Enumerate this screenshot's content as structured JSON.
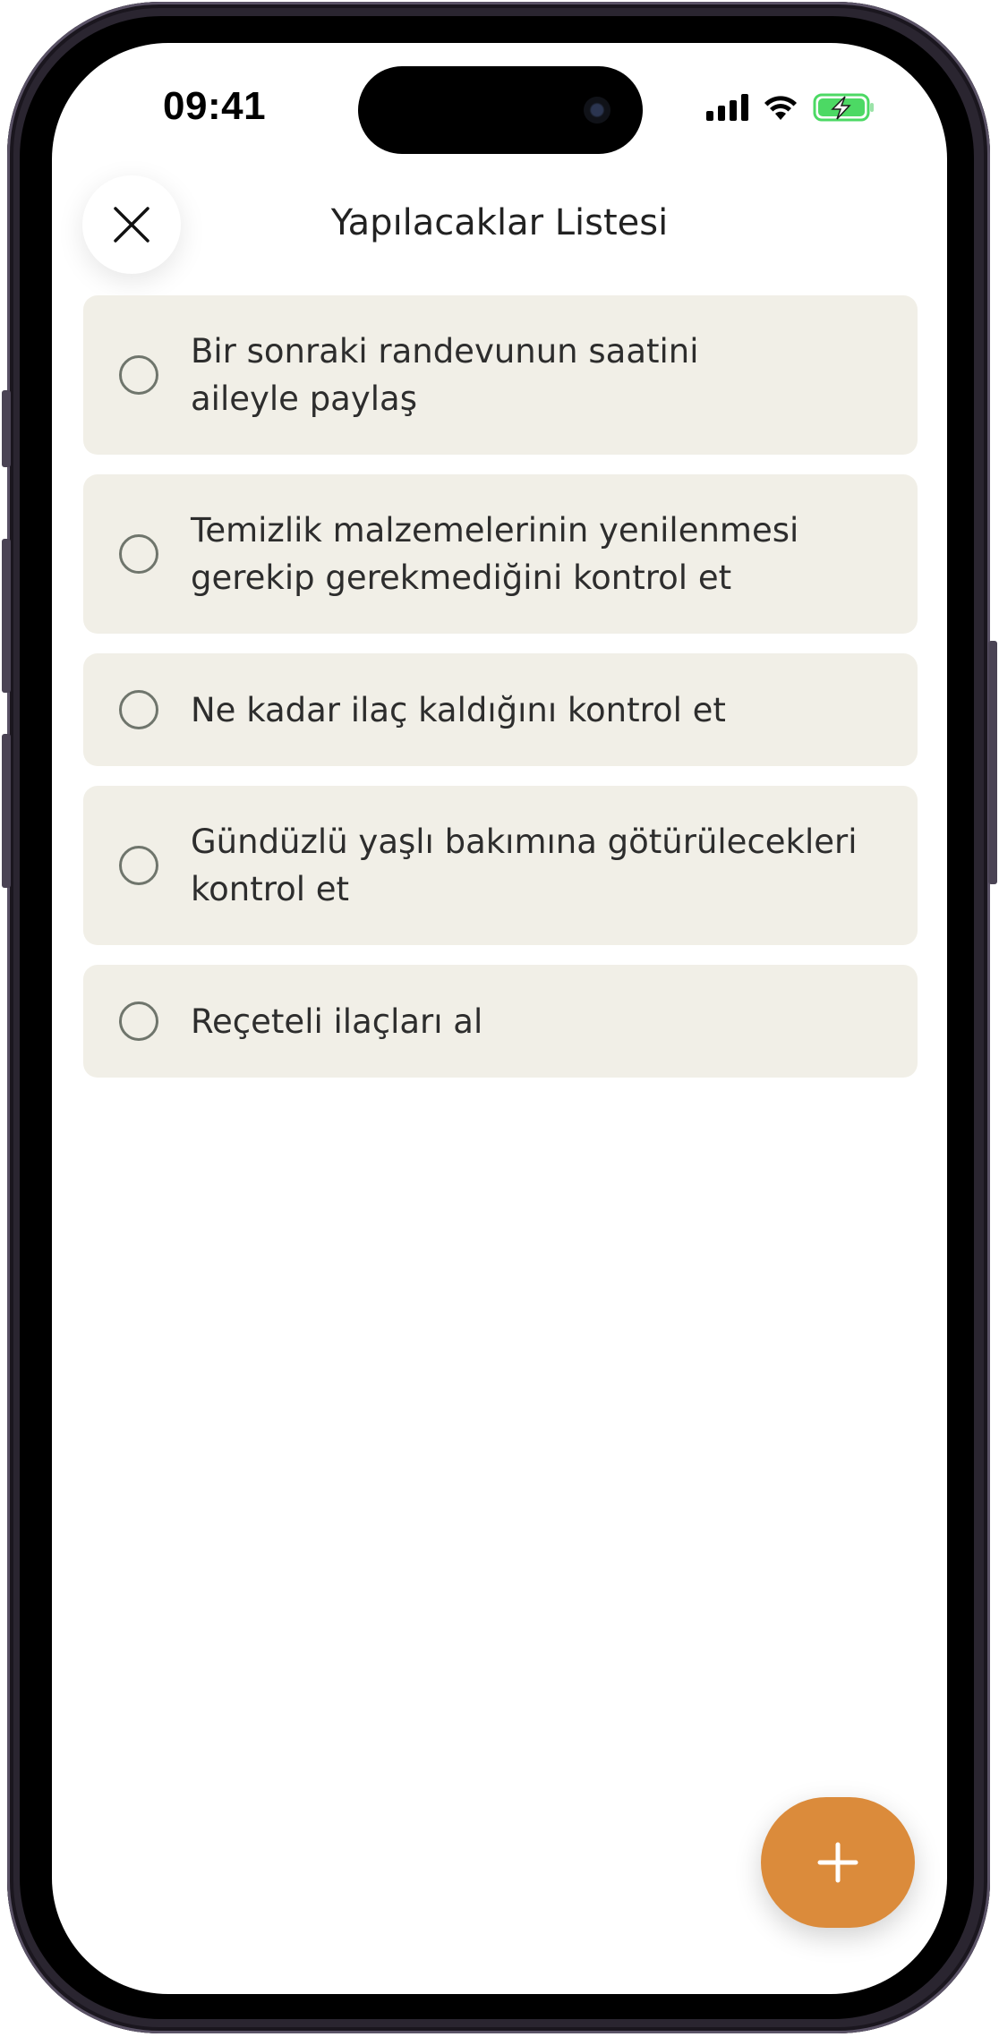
{
  "status_bar": {
    "time": "09:41",
    "icons": [
      "cellular-signal-icon",
      "wifi-icon",
      "battery-charging-icon"
    ],
    "battery_color": "#4cd964"
  },
  "header": {
    "title": "Yapılacaklar Listesi",
    "close_icon": "close-icon"
  },
  "tasks": [
    {
      "text": "Bir sonraki randevunun saatini\naileyle paylaş",
      "done": false
    },
    {
      "text": "Temizlik malzemelerinin yenilenmesi\ngerekip gerekmediğini kontrol et",
      "done": false
    },
    {
      "text": "Ne kadar ilaç kaldığını kontrol et",
      "done": false
    },
    {
      "text": "Gündüzlü yaşlı bakımına götürülecekleri\nkontrol et",
      "done": false
    },
    {
      "text": "Reçeteli ilaçları al",
      "done": false
    }
  ],
  "fab": {
    "icon": "plus-icon",
    "color": "#db8b3b"
  },
  "colors": {
    "card_background": "#f1efe7",
    "checkbox_border": "#6f756c",
    "accent": "#db8b3b"
  }
}
